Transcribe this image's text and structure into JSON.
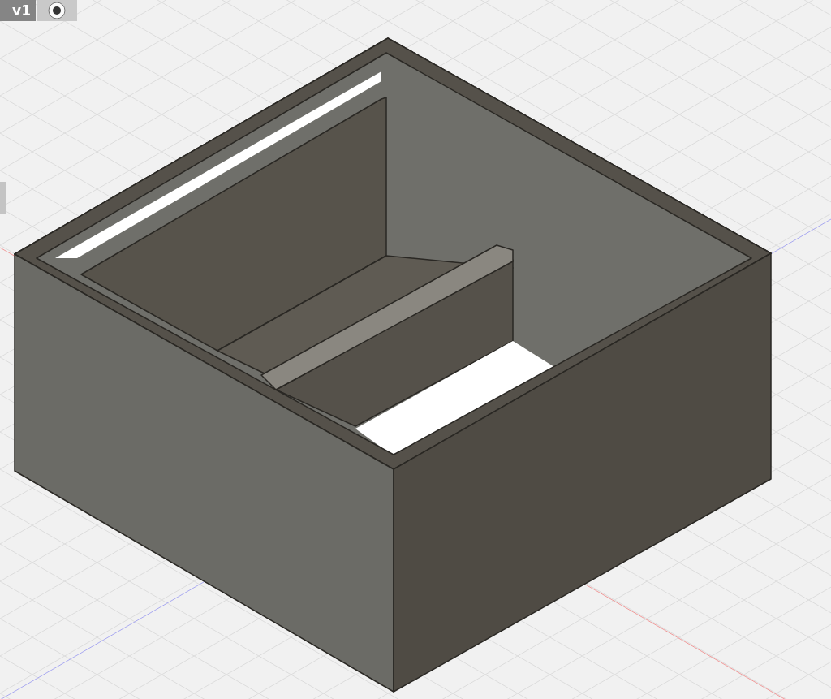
{
  "document": {
    "version": "v1"
  }
}
